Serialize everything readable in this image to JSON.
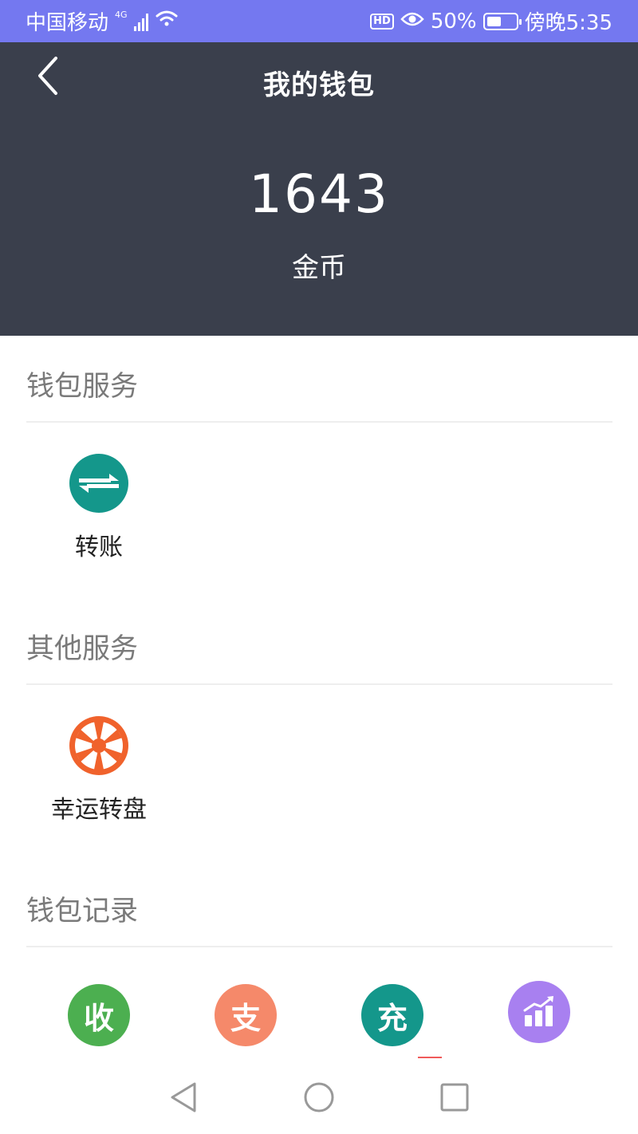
{
  "status_bar": {
    "carrier": "中国移动",
    "network": "4G",
    "battery_percent": "50%",
    "battery_level": 0.5,
    "time": "傍晚5:35",
    "hd_label": "HD",
    "icons": [
      "signal-icon",
      "wifi-icon",
      "hd-icon",
      "eye-icon",
      "battery-icon"
    ]
  },
  "header": {
    "title": "我的钱包",
    "back_icon": "chevron-left-icon",
    "balance": "1643",
    "unit": "金币"
  },
  "sections": {
    "wallet_services": {
      "title": "钱包服务",
      "items": [
        {
          "label": "转账",
          "icon": "transfer-icon",
          "color": "#14978b"
        }
      ]
    },
    "other_services": {
      "title": "其他服务",
      "items": [
        {
          "label": "幸运转盘",
          "icon": "lucky-wheel-icon",
          "color": "#f0622c"
        }
      ]
    },
    "wallet_records": {
      "title": "钱包记录",
      "items": [
        {
          "glyph": "收",
          "icon": "income-icon",
          "color": "#4caf50"
        },
        {
          "glyph": "支",
          "icon": "expense-icon",
          "color": "#f5896a"
        },
        {
          "glyph": "充",
          "icon": "recharge-icon",
          "color": "#14978b"
        },
        {
          "glyph": "",
          "icon": "stats-chart-icon",
          "color": "#a880f0"
        }
      ]
    }
  },
  "nav_bar": {
    "icons": [
      "back-triangle-icon",
      "home-circle-icon",
      "recents-square-icon"
    ]
  }
}
